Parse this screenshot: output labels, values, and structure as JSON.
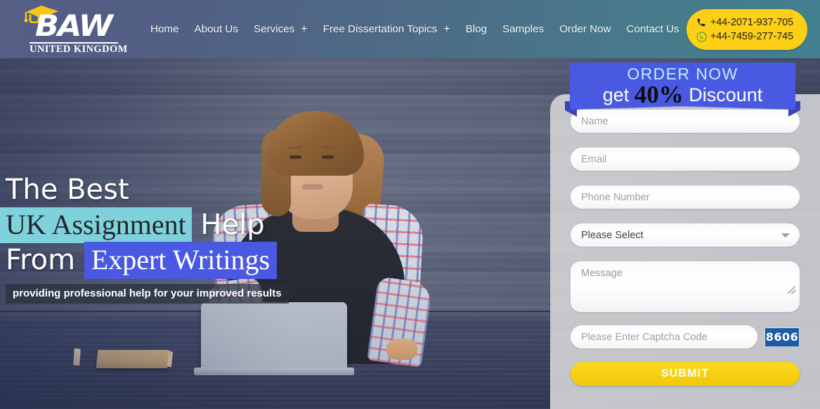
{
  "header": {
    "logo": {
      "word": "BAW",
      "subtitle": "UNITED KINGDOM",
      "cap_icon": "graduation-cap-icon"
    },
    "nav": [
      {
        "label": "Home",
        "has_plus": false
      },
      {
        "label": "About Us",
        "has_plus": false
      },
      {
        "label": "Services",
        "has_plus": true,
        "plus": "+"
      },
      {
        "label": "Free Dissertation Topics",
        "has_plus": true,
        "plus": "+"
      },
      {
        "label": "Blog",
        "has_plus": false
      },
      {
        "label": "Samples",
        "has_plus": false
      },
      {
        "label": "Order Now",
        "has_plus": false
      },
      {
        "label": "Contact Us",
        "has_plus": false
      }
    ],
    "contact": {
      "phone": "+44-2071-937-705",
      "whatsapp": "+44-7459-277-745",
      "phone_icon": "phone-icon",
      "whatsapp_icon": "whatsapp-icon",
      "pill_color": "#fdd017"
    }
  },
  "hero": {
    "headline": {
      "line1": "The Best",
      "line2_highlight": "UK Assignment",
      "line2_rest": "Help",
      "line3_prefix": "From",
      "line3_highlight": "Expert Writings"
    },
    "subtitle": "providing professional help for your improved results",
    "highlight_teal": "#7fd2db",
    "highlight_blue": "#4a59e2"
  },
  "form": {
    "ribbon": {
      "top": "ORDER NOW",
      "bottom_prefix": "get",
      "bottom_percent": "40%",
      "bottom_suffix": "Discount",
      "color": "#4a59e2",
      "top_color": "#b9f0ff"
    },
    "fields": {
      "name_placeholder": "Name",
      "name_value": "",
      "email_placeholder": "Email",
      "email_value": "",
      "phone_placeholder": "Phone Number",
      "phone_value": "",
      "select_value": "Please Select",
      "select_options": [
        "Please Select"
      ],
      "message_placeholder": "Message",
      "message_value": "",
      "captcha_placeholder": "Please Enter Captcha Code",
      "captcha_value": "",
      "captcha_code": "8606"
    },
    "submit_label": "SUBMIT",
    "submit_color": "#f7cf12"
  }
}
